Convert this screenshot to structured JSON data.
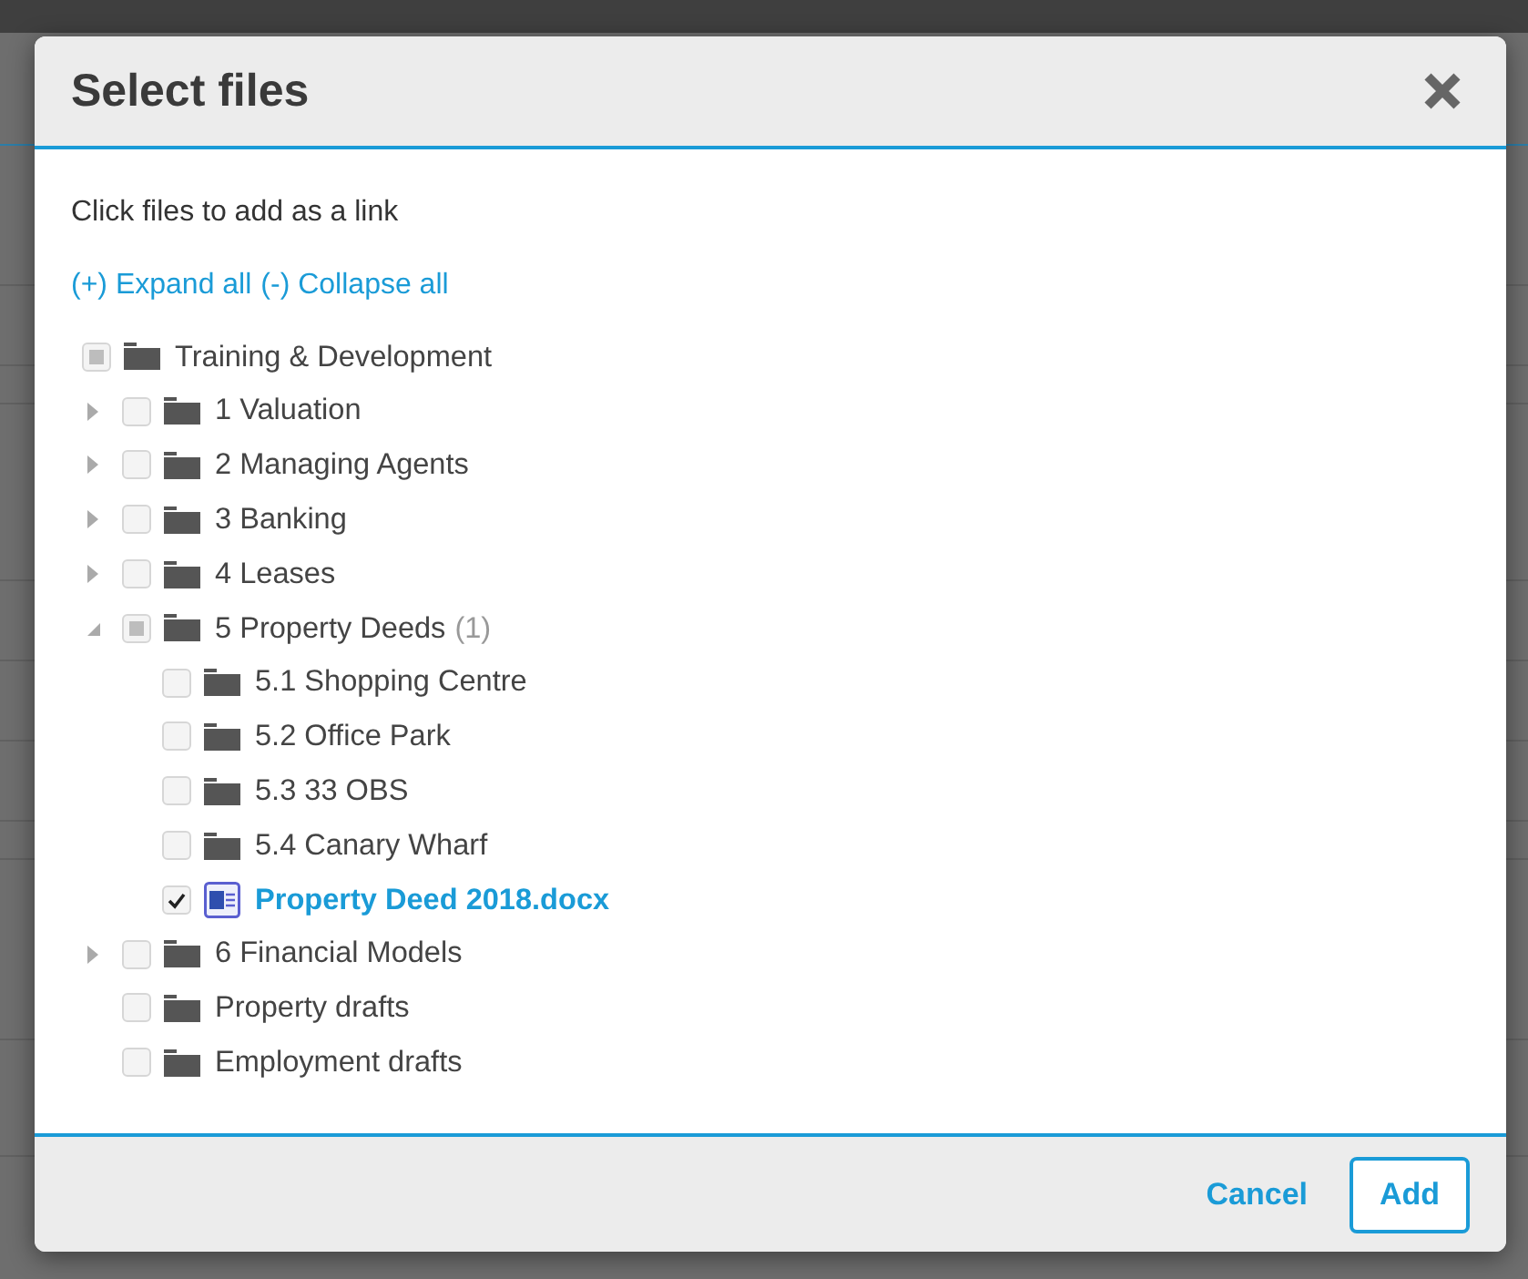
{
  "dialog": {
    "title": "Select files"
  },
  "instruction": "Click files to add as a link",
  "tree_actions": [
    "(+) Expand all",
    "(-) Collapse all"
  ],
  "tree": [
    {
      "kind": "folder",
      "label": "Training & Development",
      "checked": false,
      "indeterminate": true,
      "children": [
        {
          "kind": "folder",
          "label": "1 Valuation",
          "expanded": false,
          "checked": false,
          "indeterminate": false
        },
        {
          "kind": "folder",
          "label": "2 Managing Agents",
          "expanded": false,
          "checked": false,
          "indeterminate": false
        },
        {
          "kind": "folder",
          "label": "3 Banking",
          "expanded": false,
          "checked": false,
          "indeterminate": false
        },
        {
          "kind": "folder",
          "label": "4 Leases",
          "expanded": false,
          "checked": false,
          "indeterminate": false
        },
        {
          "kind": "folder",
          "label": "5 Property Deeds",
          "count": "(1)",
          "expanded": true,
          "checked": false,
          "indeterminate": true,
          "children": [
            {
              "kind": "folder",
              "label": "5.1 Shopping Centre",
              "checked": false,
              "indeterminate": false
            },
            {
              "kind": "folder",
              "label": "5.2 Office Park",
              "checked": false,
              "indeterminate": false
            },
            {
              "kind": "folder",
              "label": "5.3 33 OBS",
              "checked": false,
              "indeterminate": false
            },
            {
              "kind": "folder",
              "label": "5.4 Canary Wharf",
              "checked": false,
              "indeterminate": false
            },
            {
              "kind": "file",
              "label": "Property Deed 2018.docx",
              "checked": true,
              "indeterminate": false
            }
          ]
        },
        {
          "kind": "folder",
          "label": "6 Financial Models",
          "expanded": false,
          "checked": false,
          "indeterminate": false
        },
        {
          "kind": "folder",
          "label": "Property drafts",
          "checked": false,
          "indeterminate": false
        },
        {
          "kind": "folder",
          "label": "Employment drafts",
          "checked": false,
          "indeterminate": false
        }
      ]
    }
  ],
  "buttons": [
    {
      "kind": "link",
      "label": "Cancel"
    },
    {
      "kind": "outline",
      "label": "Add"
    }
  ]
}
